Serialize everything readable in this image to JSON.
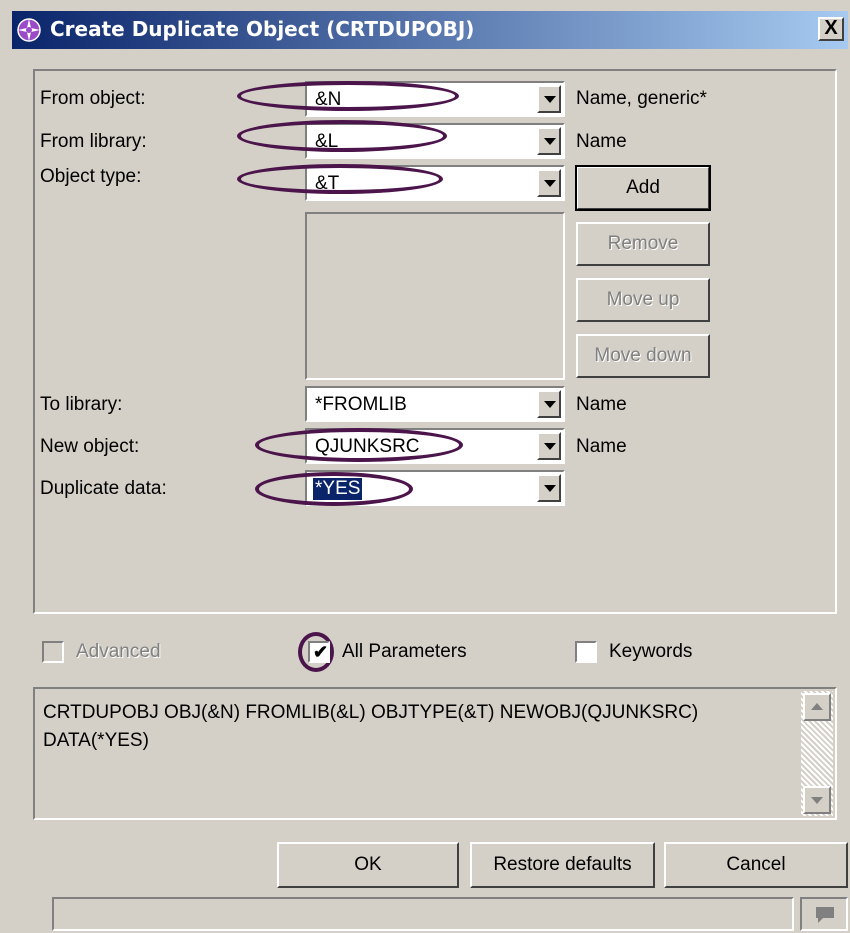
{
  "window": {
    "title": "Create Duplicate Object (CRTDUPOBJ)",
    "title_icon": "compass-icon",
    "close_label": "X"
  },
  "fields": {
    "from_object": {
      "label": "From object:",
      "value": "&N",
      "hint": "Name, generic*"
    },
    "from_library": {
      "label": "From library:",
      "value": "&L",
      "hint": "Name"
    },
    "object_type": {
      "label": "Object type:",
      "value": "&T"
    },
    "to_library": {
      "label": "To library:",
      "value": "*FROMLIB",
      "hint": "Name"
    },
    "new_object": {
      "label": "New object:",
      "value": "QJUNKSRC",
      "hint": "Name"
    },
    "duplicate_data": {
      "label": "Duplicate data:",
      "value": "*YES"
    }
  },
  "list_buttons": {
    "add": "Add",
    "remove": "Remove",
    "move_up": "Move up",
    "move_down": "Move down"
  },
  "options": {
    "advanced": {
      "label": "Advanced",
      "checked": false,
      "enabled": false
    },
    "all_parameters": {
      "label": "All Parameters",
      "checked": true
    },
    "keywords": {
      "label": "Keywords",
      "checked": false
    }
  },
  "command_text": "CRTDUPOBJ OBJ(&N) FROMLIB(&L) OBJTYPE(&T) NEWOBJ(QJUNKSRC)\nDATA(*YES)",
  "buttons": {
    "ok": "OK",
    "restore": "Restore defaults",
    "cancel": "Cancel"
  },
  "colors": {
    "annotation_oval": "#4b154b",
    "title_bar": "#0a246a",
    "selection": "#0a246a"
  }
}
